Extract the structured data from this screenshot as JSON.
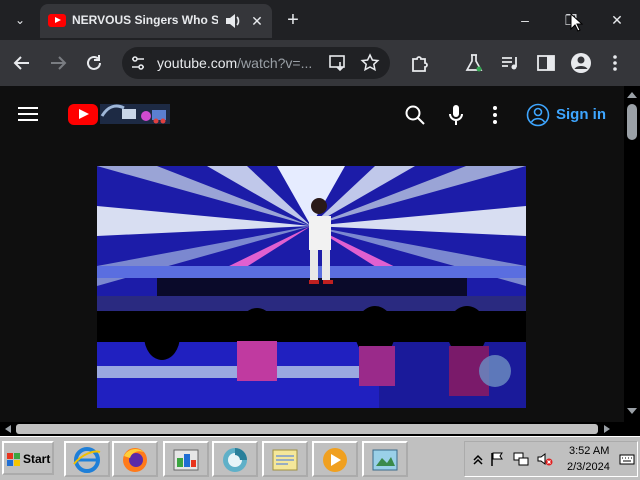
{
  "browser": {
    "tab": {
      "title": "NERVOUS Singers Who SH",
      "close_symbol": "✕"
    },
    "new_tab_symbol": "+",
    "tab_menu_symbol": "⌄",
    "window_controls": {
      "minimize": "–",
      "restore": "❐",
      "close": "✕"
    },
    "address": {
      "host": "youtube.com",
      "path": "/watch?v=..."
    }
  },
  "youtube": {
    "sign_in_label": "Sign in",
    "colors": {
      "brand": "#ff0000",
      "signin": "#3ea6ff",
      "background": "#0f0f0f"
    }
  },
  "taskbar": {
    "start_label": "Start",
    "clock": {
      "time": "3:52 AM",
      "date": "2/3/2024"
    },
    "apps": [
      "internet-explorer-icon",
      "firefox-icon",
      "control-panel-icon",
      "app-icon",
      "notes-icon",
      "media-player-icon",
      "network-icon"
    ]
  }
}
